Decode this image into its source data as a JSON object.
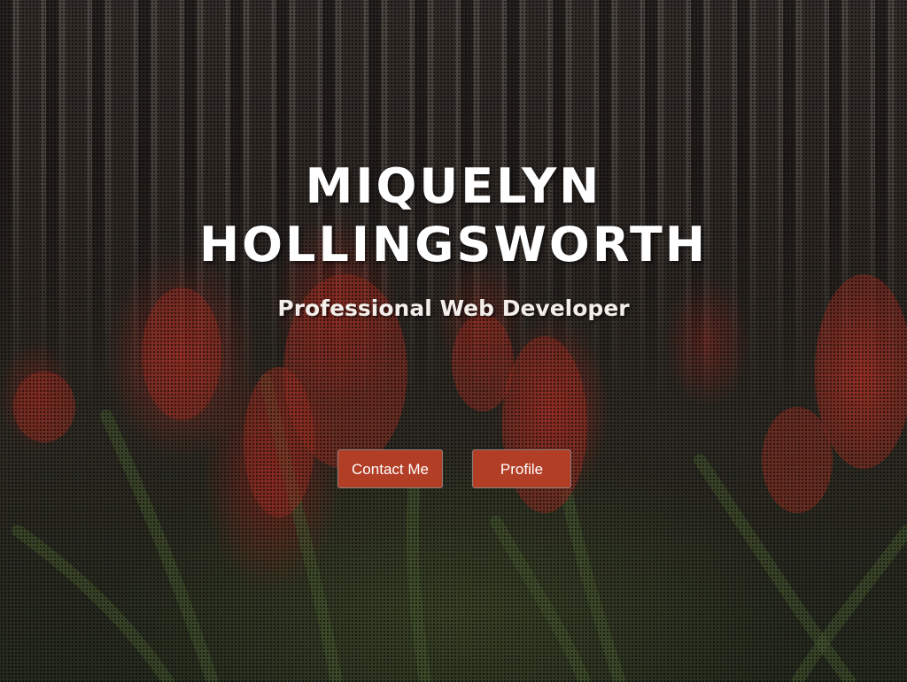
{
  "hero": {
    "name_line1": "MIQUELYN",
    "name_line2": "HOLLINGSWORTH",
    "tagline": "Professional Web Developer",
    "background_description_icon": "tulip-photo",
    "accent_color": "#b33e26"
  },
  "buttons": {
    "contact_label": "Contact Me",
    "profile_label": "Profile"
  }
}
